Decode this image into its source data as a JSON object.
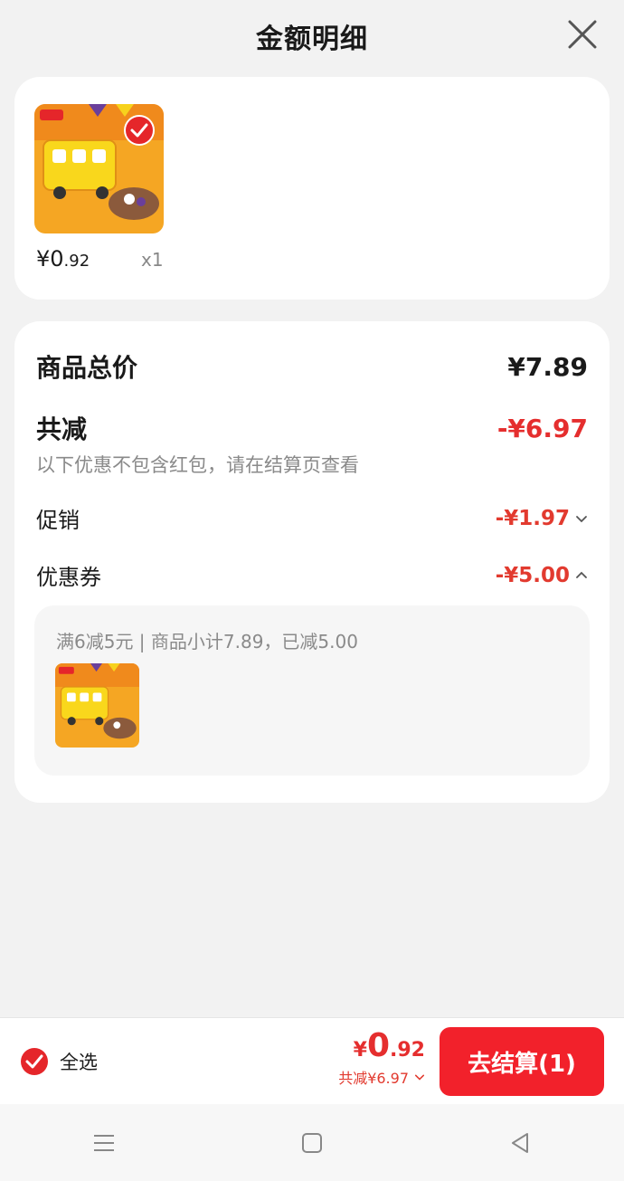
{
  "header": {
    "title": "金额明细",
    "close_icon": "close-icon"
  },
  "product": {
    "price_prefix": "¥0",
    "price_decimal": ".92",
    "quantity": "x1",
    "selected": true
  },
  "summary": {
    "total_label": "商品总价",
    "total_value": "¥7.89",
    "discount_label": "共减",
    "discount_value": "-¥6.97",
    "note": "以下优惠不包含红包，请在结算页查看",
    "promo_label": "促销",
    "promo_value": "-¥1.97",
    "coupon_label": "优惠券",
    "coupon_value": "-¥5.00"
  },
  "coupon_detail": {
    "desc": "满6减5元 | 商品小计7.89，已减5.00"
  },
  "bottom_bar": {
    "select_all_label": "全选",
    "total_currency": "¥",
    "total_int": "0",
    "total_dec": ".92",
    "total_sub": "共减¥6.97",
    "checkout_label": "去结算(1)"
  },
  "navbar": {
    "items": [
      "menu-icon",
      "home-icon",
      "back-icon"
    ]
  },
  "colors": {
    "accent_red": "#f2212b",
    "discount_red": "#e23a2f",
    "background": "#f2f2f2"
  }
}
